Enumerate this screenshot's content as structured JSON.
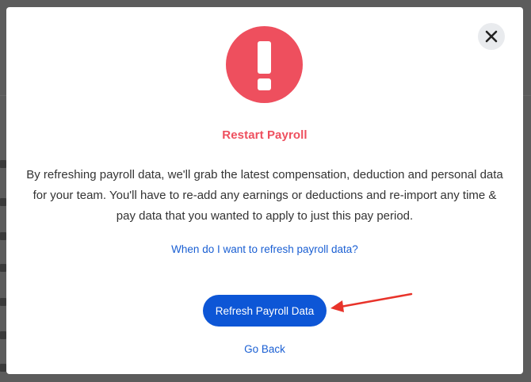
{
  "modal": {
    "title": "Restart Payroll",
    "body": "By refreshing payroll data, we'll grab the latest compensation, deduction and personal data for your team. You'll have to re-add any earnings or deductions and re-import any time & pay data that you wanted to apply to just this pay period.",
    "help_link": "When do I want to refresh payroll data?",
    "primary_button": "Refresh Payroll Data",
    "secondary_link": "Go Back",
    "alert_icon": "exclamation-icon",
    "close_icon": "close-icon"
  },
  "colors": {
    "alert": "#ee4f5e",
    "link": "#1a5fd3",
    "primary": "#0d56d6",
    "annotation": "#e8332a"
  }
}
